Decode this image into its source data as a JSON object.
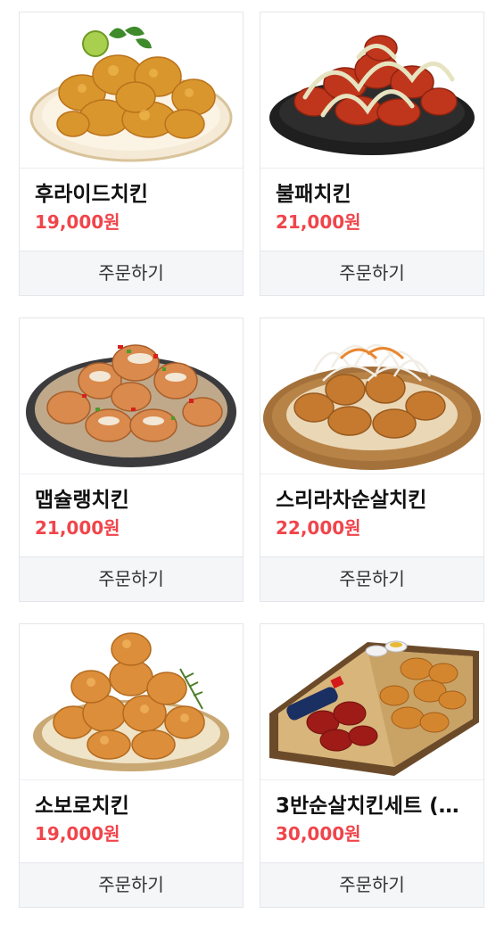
{
  "products": [
    {
      "name": "후라이드치킨",
      "price": "19,000원",
      "order_label": "주문하기",
      "image": "fried-chicken-plate"
    },
    {
      "name": "불패치킨",
      "price": "21,000원",
      "order_label": "주문하기",
      "image": "sauced-chicken-plate"
    },
    {
      "name": "맵슐랭치킨",
      "price": "21,000원",
      "order_label": "주문하기",
      "image": "spicy-cream-chicken-plate"
    },
    {
      "name": "스리라차순살치킨",
      "price": "22,000원",
      "order_label": "주문하기",
      "image": "sriracha-onion-chicken-plate"
    },
    {
      "name": "소보로치킨",
      "price": "19,000원",
      "order_label": "주문하기",
      "image": "soboro-chicken-plate"
    },
    {
      "name": "3반순살치킨세트 (…",
      "price": "30,000원",
      "order_label": "주문하기",
      "image": "chicken-set-box"
    }
  ]
}
